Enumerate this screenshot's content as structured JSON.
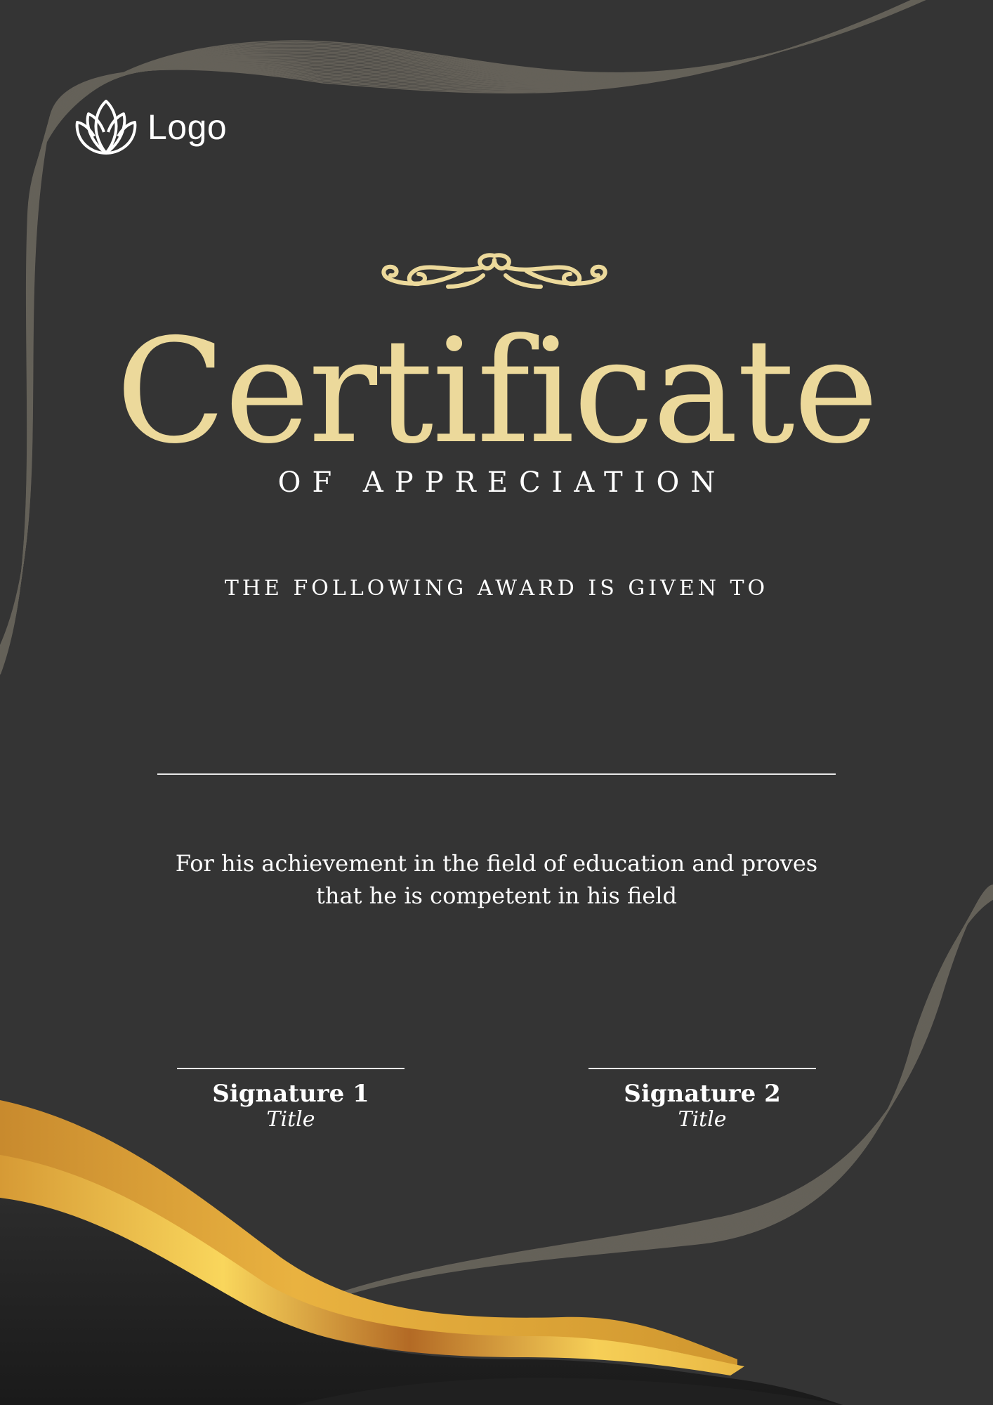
{
  "logo": {
    "text": "Logo",
    "icon": "lotus-icon"
  },
  "certificate": {
    "title": "Certificate",
    "subtitle": "OF APPRECIATION",
    "given_to": "THE FOLLOWING AWARD IS GIVEN TO",
    "description": "For his achievement in the field of education and proves that he is competent in his field"
  },
  "signatures": [
    {
      "name": "Signature 1",
      "title": "Title"
    },
    {
      "name": "Signature 2",
      "title": "Title"
    }
  ],
  "colors": {
    "background": "#343434",
    "title_gold": "#ecd99b",
    "wave_gold": "#f5cf5a",
    "line_pattern": "#6e6a60",
    "text": "#ffffff"
  }
}
